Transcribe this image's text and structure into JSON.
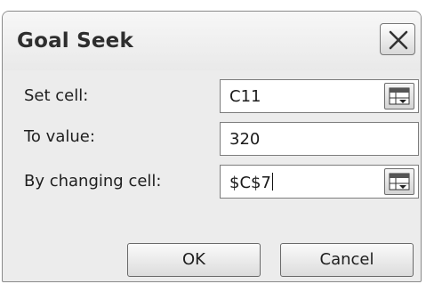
{
  "dialog": {
    "title": "Goal Seek",
    "close_icon": "close-icon"
  },
  "fields": {
    "set_cell": {
      "label": "Set cell:",
      "value": "C11"
    },
    "to_value": {
      "label": "To value:",
      "value": "320"
    },
    "by_changing_cell": {
      "label": "By changing cell:",
      "value": "$C$7"
    }
  },
  "buttons": {
    "ok": "OK",
    "cancel": "Cancel"
  },
  "icons": {
    "cell_reference": "collapse-dialog-icon"
  }
}
